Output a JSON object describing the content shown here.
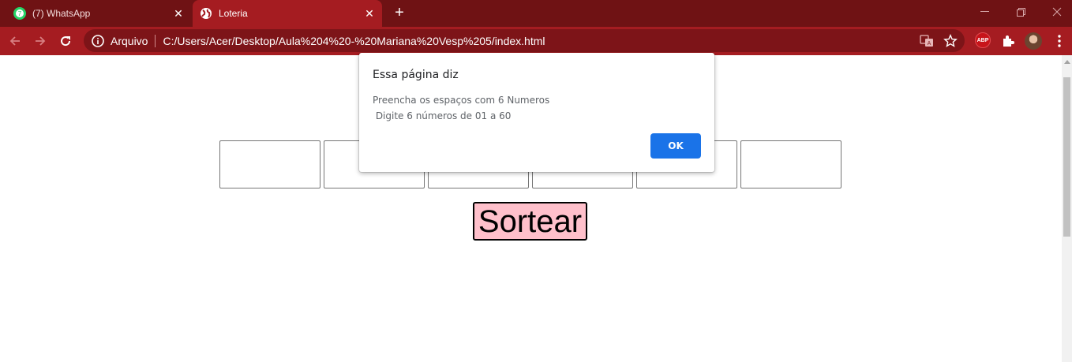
{
  "tabs": [
    {
      "title": "(7) WhatsApp",
      "badge": "7",
      "icon": "whatsapp-icon",
      "active": false
    },
    {
      "title": "Loteria",
      "icon": "globe-icon",
      "active": true
    }
  ],
  "toolbar": {
    "scheme_label": "Arquivo",
    "url": "C:/Users/Acer/Desktop/Aula%204%20-%20Mariana%20Vesp%205/index.html",
    "extensions": {
      "abp_label": "ABP"
    }
  },
  "page": {
    "button_label": "Sortear",
    "input_count": 6,
    "button_bg": "#ffc0cb"
  },
  "dialog": {
    "title": "Essa página diz",
    "message_line1": "Preencha os espaços com 6 Numeros",
    "message_line2": " Digite 6 números de 01 a 60",
    "ok_label": "OK",
    "ok_color": "#1a73e8"
  },
  "theme": {
    "tabstrip_bg": "#6f1214",
    "toolbar_bg": "#a51c21",
    "omnibox_bg": "#7d1418"
  }
}
